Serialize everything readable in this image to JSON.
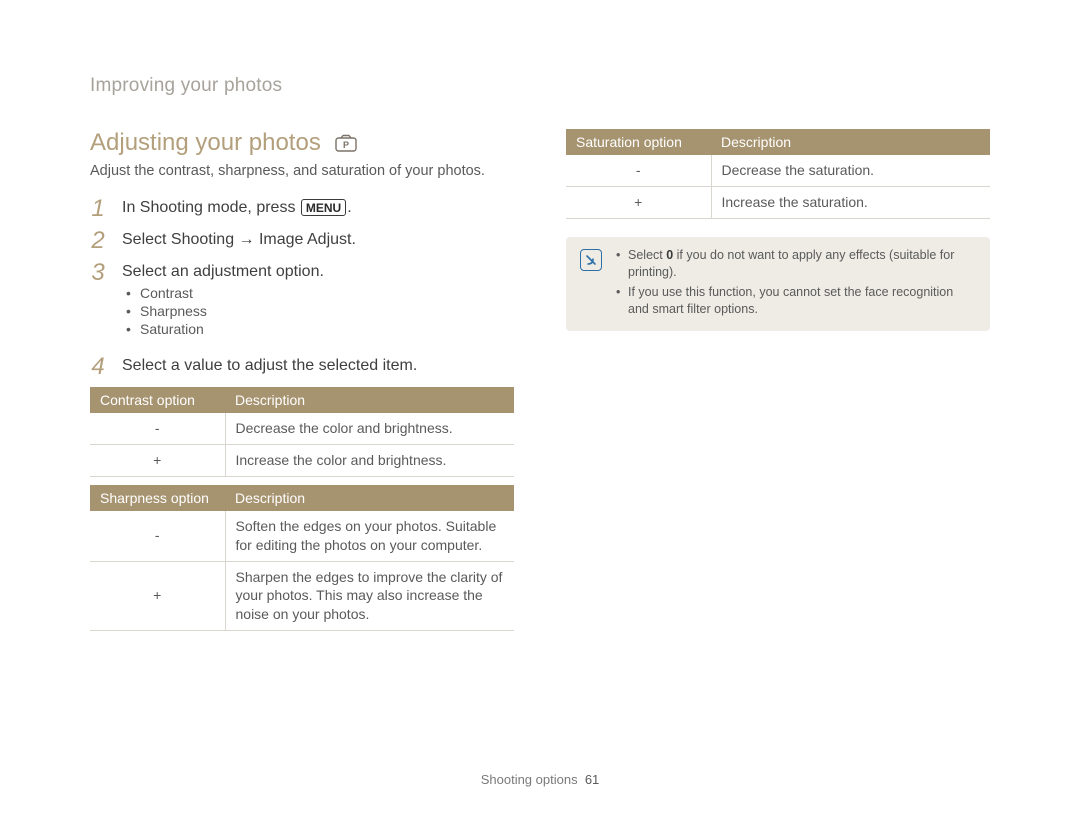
{
  "header": {
    "breadcrumb": "Improving your photos"
  },
  "section": {
    "title": "Adjusting your photos",
    "mode_icon": "camera-p-icon",
    "intro": "Adjust the contrast, sharpness, and saturation of your photos."
  },
  "steps": {
    "s1": {
      "num": "1",
      "pre": "In Shooting mode, press ",
      "menu_label": "MENU",
      "post": "."
    },
    "s2": {
      "num": "2",
      "pre": "Select ",
      "bold": "Shooting → Image Adjust",
      "post": "."
    },
    "s3": {
      "num": "3",
      "text": "Select an adjustment option.",
      "items": [
        "Contrast",
        "Sharpness",
        "Saturation"
      ]
    },
    "s4": {
      "num": "4",
      "text": "Select a value to adjust the selected item."
    }
  },
  "tables": {
    "contrast": {
      "h1": "Contrast option",
      "h2": "Description",
      "rows": [
        {
          "opt": "-",
          "desc": "Decrease the color and brightness."
        },
        {
          "opt": "+",
          "desc": "Increase the color and brightness."
        }
      ]
    },
    "sharpness": {
      "h1": "Sharpness option",
      "h2": "Description",
      "rows": [
        {
          "opt": "-",
          "desc": "Soften the edges on your photos. Suitable for editing the photos on your computer."
        },
        {
          "opt": "+",
          "desc": "Sharpen the edges to improve the clarity of your photos. This may also increase the noise on your photos."
        }
      ]
    },
    "saturation": {
      "h1": "Saturation option",
      "h2": "Description",
      "rows": [
        {
          "opt": "-",
          "desc": "Decrease the saturation."
        },
        {
          "opt": "+",
          "desc": "Increase the saturation."
        }
      ]
    }
  },
  "notes": {
    "n1_pre": "Select ",
    "n1_bold": "0",
    "n1_post": " if you do not want to apply any effects (suitable for printing).",
    "n2": "If you use this function, you cannot set the face recognition and smart filter options."
  },
  "footer": {
    "section": "Shooting options",
    "page": "61"
  }
}
